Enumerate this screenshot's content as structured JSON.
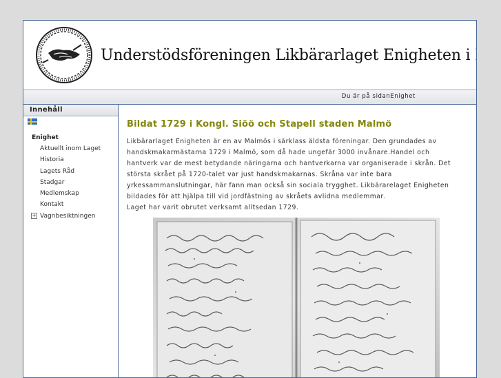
{
  "header": {
    "site_title": "Understödsföreningen Likbärarlaget Enigheten i Malmö",
    "logo_icon": "wreath-handshake-logo-icon"
  },
  "location_bar": {
    "text": "Du är på sidanEnighet"
  },
  "sidebar": {
    "title": "Innehåll",
    "language_icon": "swedish-flag-icon",
    "group": "Enighet",
    "items": [
      {
        "label": "Aktuellt inom Laget"
      },
      {
        "label": "Historia"
      },
      {
        "label": "Lagets Råd"
      },
      {
        "label": "Stadgar"
      },
      {
        "label": "Medlemskap"
      },
      {
        "label": "Kontakt"
      }
    ],
    "expandable_item": {
      "label": "Vagnbesiktningen",
      "icon": "plus-expand-icon"
    }
  },
  "main": {
    "heading": "Bildat 1729 i Kongl. Siöö och Stapell staden Malmö",
    "paragraph_lines": [
      "Likbärarlaget Enigheten är en av Malmös i särklass äldsta föreningar. Den grundades av",
      "handskmakarmästarna 1729 i Malmö, som då hade ungefär 3000 invånare.Handel och",
      "hantverk var de mest betydande näringarna och hantverkarna var organiserade i skrån. Det",
      "största skrået på 1720-talet var just handskmakarnas. Skråna var inte bara",
      "yrkessammanslutningar, här fann man också sin sociala trygghet. Likbärarelaget Enigheten",
      "bildades för att hjälpa till vid jordfästning av skråets avlidna medlemmar.",
      "Laget har varit obrutet verksamt alltsedan 1729."
    ],
    "image_icon": "handwritten-manuscript-image"
  },
  "colors": {
    "border": "#4d6a98",
    "heading": "#86860b",
    "background": "#dcdcdc"
  }
}
